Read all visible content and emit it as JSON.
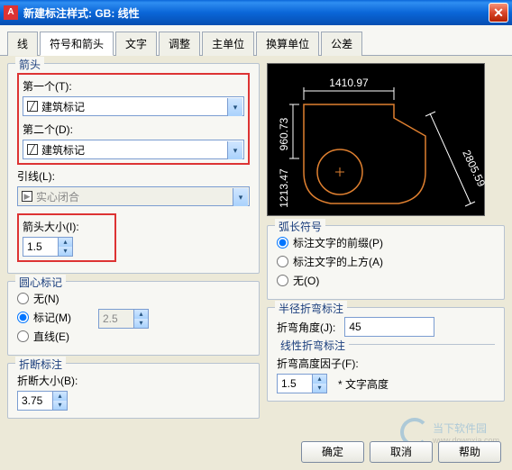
{
  "window": {
    "title": "新建标注样式: GB: 线性"
  },
  "tabs": [
    "线",
    "符号和箭头",
    "文字",
    "调整",
    "主单位",
    "换算单位",
    "公差"
  ],
  "active_tab": 1,
  "arrowheads": {
    "legend": "箭头",
    "first_label": "第一个(T):",
    "first_value": "建筑标记",
    "second_label": "第二个(D):",
    "second_value": "建筑标记",
    "leader_label": "引线(L):",
    "leader_value": "实心闭合",
    "size_label": "箭头大小(I):",
    "size_value": "1.5"
  },
  "center": {
    "legend": "圆心标记",
    "none": "无(N)",
    "mark": "标记(M)",
    "line": "直线(E)",
    "size": "2.5",
    "selected": "mark"
  },
  "break": {
    "legend": "折断标注",
    "size_label": "折断大小(B):",
    "size_value": "3.75"
  },
  "arc": {
    "legend": "弧长符号",
    "pre": "标注文字的前缀(P)",
    "above": "标注文字的上方(A)",
    "none": "无(O)",
    "selected": "pre"
  },
  "radius_jog": {
    "legend": "半径折弯标注",
    "angle_label": "折弯角度(J):",
    "angle_value": "45"
  },
  "linear_jog": {
    "legend": "线性折弯标注",
    "factor_label": "折弯高度因子(F):",
    "factor_value": "1.5",
    "suffix": "* 文字高度"
  },
  "preview": {
    "dim1": "1410.97",
    "dim2": "2805.59",
    "dim3": "960.73",
    "dim4": "1213.47"
  },
  "buttons": {
    "ok": "确定",
    "cancel": "取消",
    "help": "帮助"
  },
  "watermark": {
    "brand": "当下软件园",
    "url": "www.downxia.com"
  }
}
